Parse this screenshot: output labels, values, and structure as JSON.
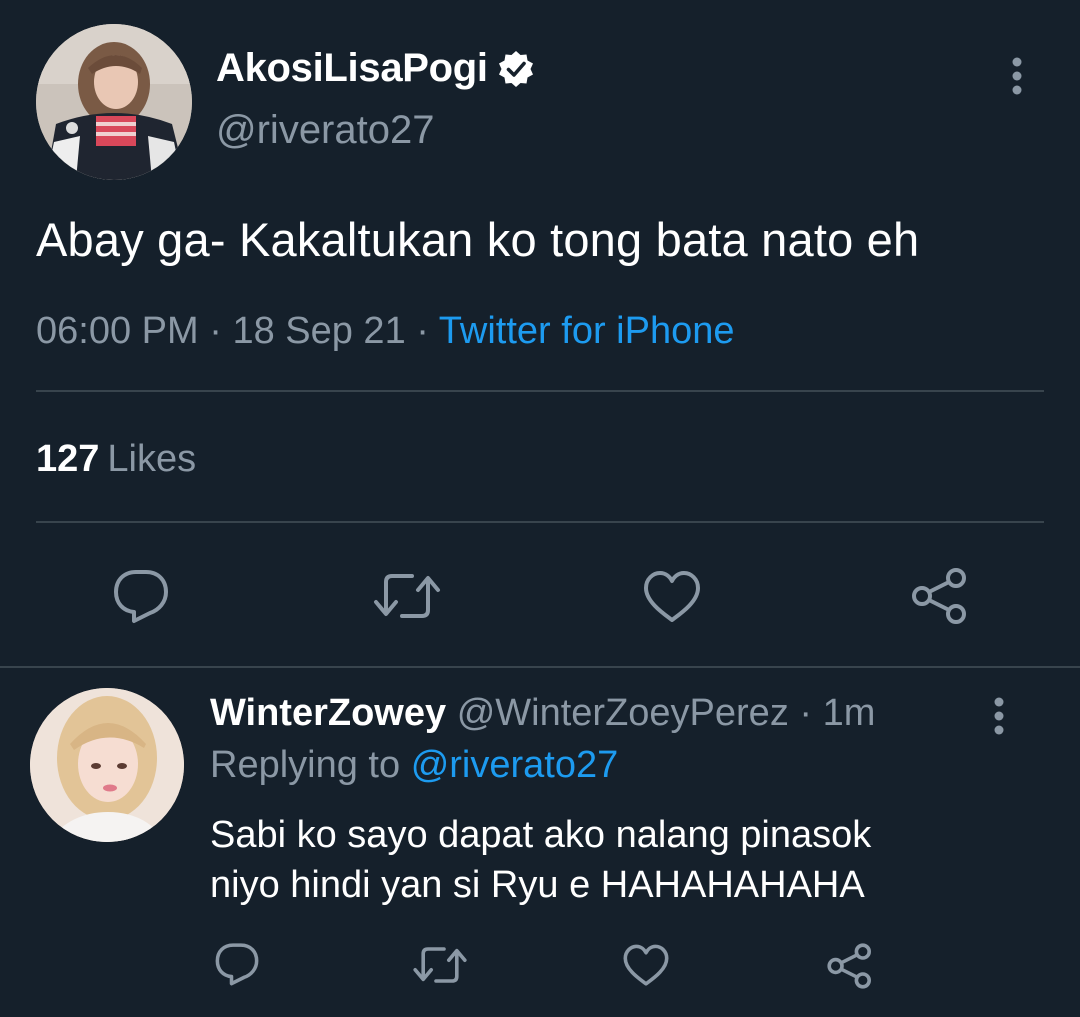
{
  "main_tweet": {
    "display_name": "AkosiLisaPogi",
    "handle": "@riverato27",
    "text": "Abay ga- Kakaltukan ko tong bata nato eh",
    "time": "06:00 PM",
    "date": "18 Sep 21",
    "source": "Twitter for iPhone",
    "separator": "·",
    "likes_count": "127",
    "likes_label": "Likes",
    "verified": true
  },
  "reply": {
    "display_name": "WinterZowey",
    "handle": "@WinterZoeyPerez",
    "separator": "·",
    "time_ago": "1m",
    "replying_to_label": "Replying to",
    "replying_to_handle": "@riverato27",
    "text_line1": "Sabi ko sayo dapat ako nalang pinasok",
    "text_line2": "niyo hindi yan si Ryu e HAHAHAHAHA"
  },
  "actions": [
    "reply-icon",
    "retweet-icon",
    "like-icon",
    "share-icon"
  ],
  "colors": {
    "background": "#15202b",
    "text_primary": "#ffffff",
    "text_secondary": "#8b98a5",
    "accent": "#1d9bf0",
    "divider": "#38444d"
  }
}
